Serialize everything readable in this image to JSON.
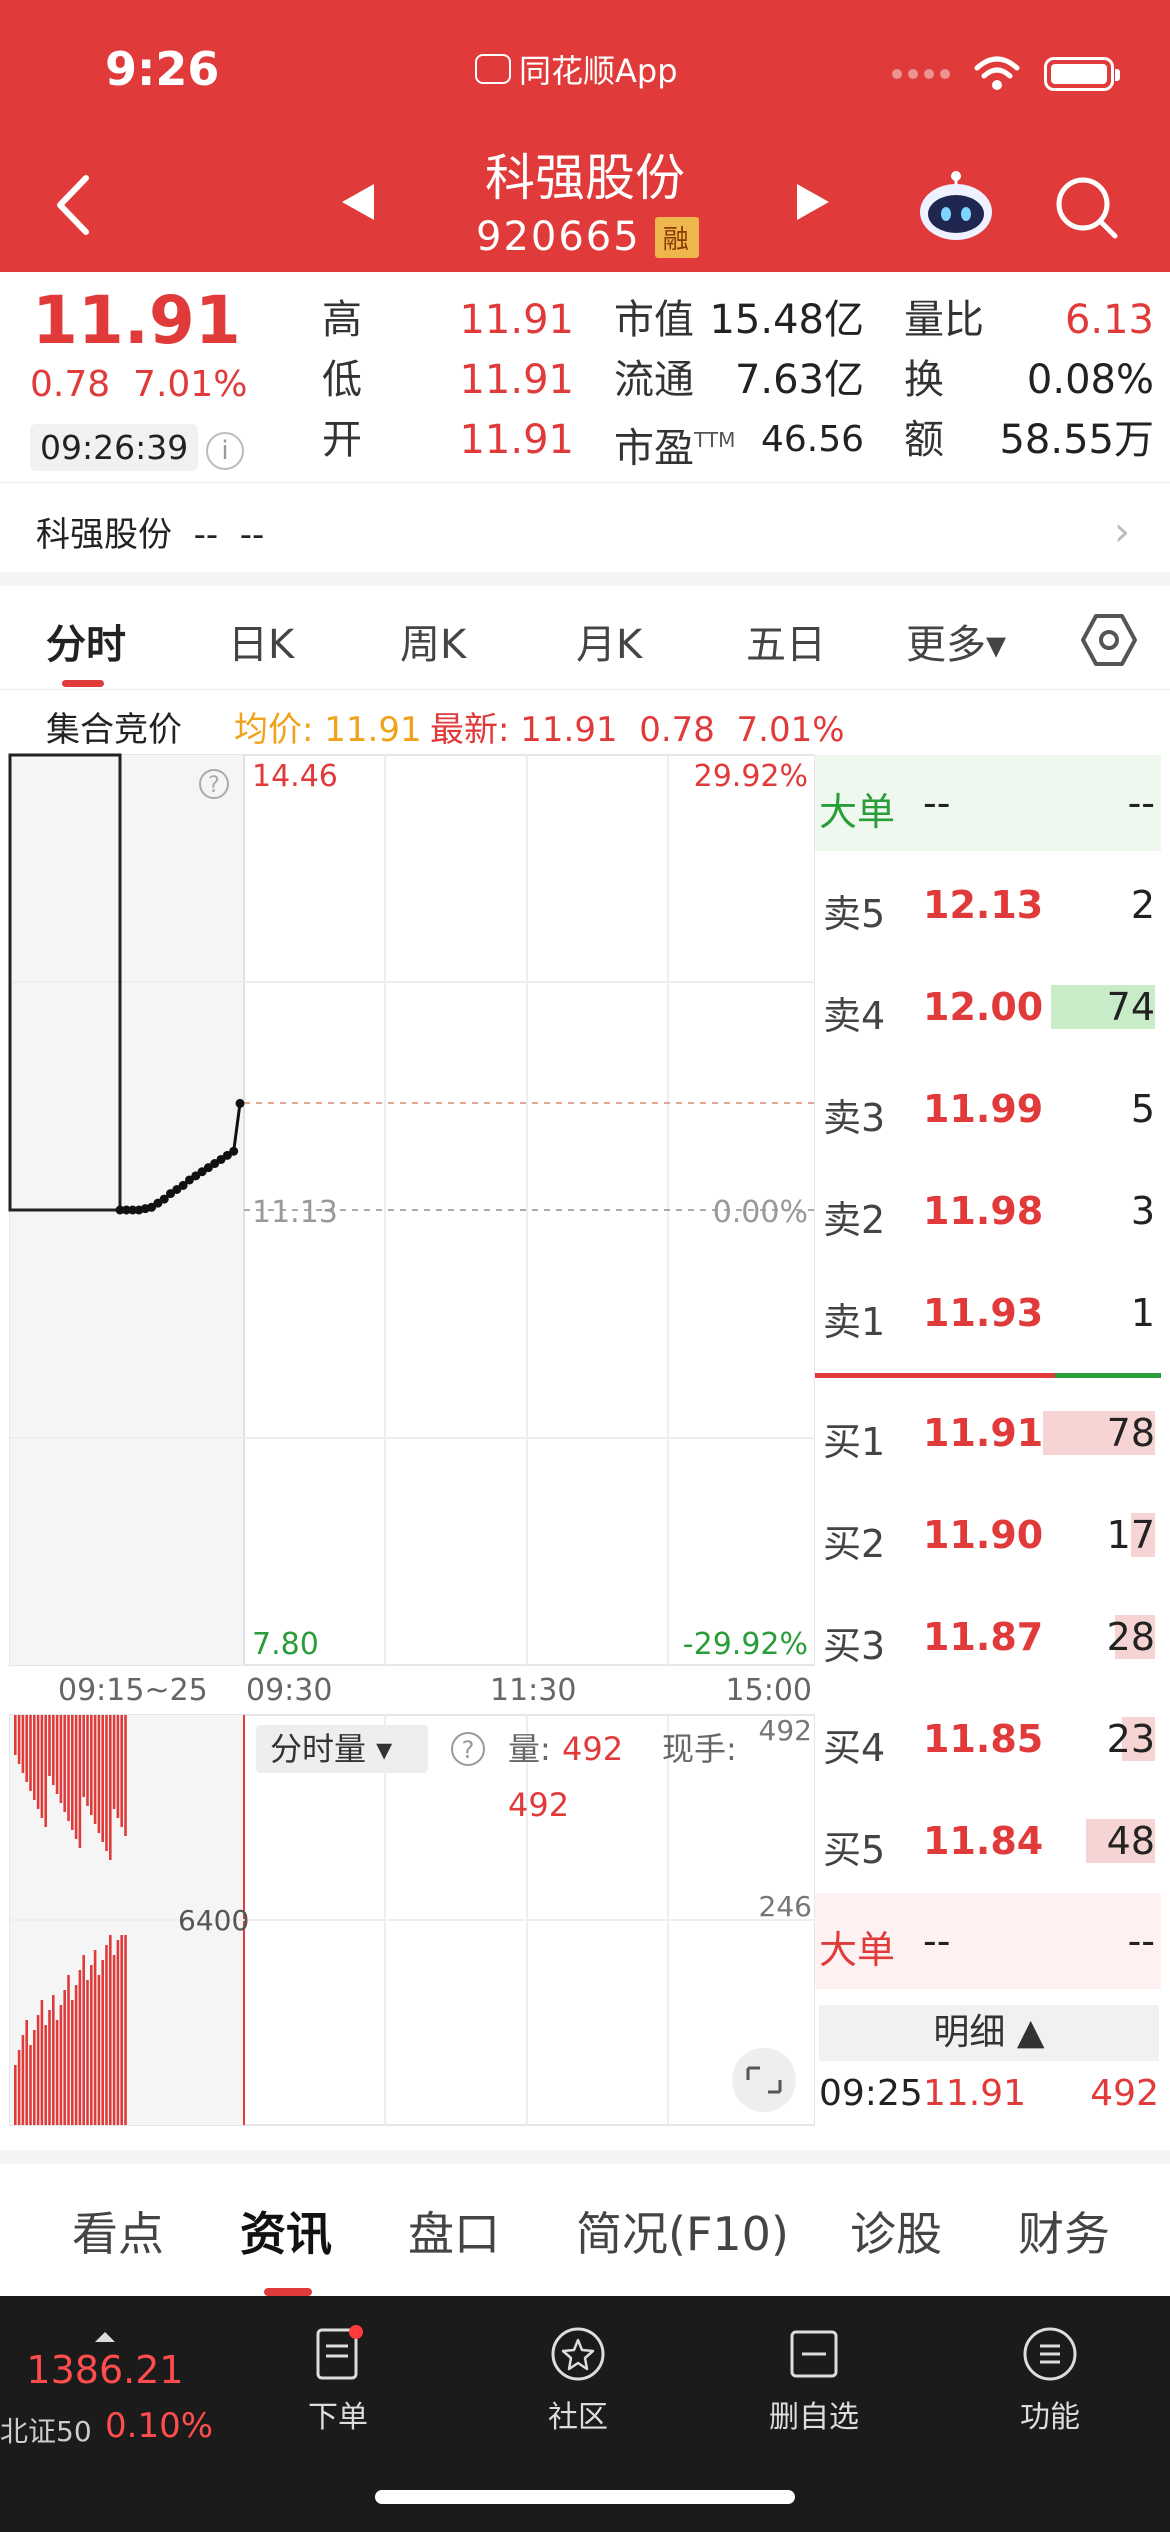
{
  "status": {
    "time": "9:26",
    "app_label": "同花顺App"
  },
  "header": {
    "stock_name": "科强股份",
    "stock_code": "920665",
    "badge": "融"
  },
  "quote": {
    "price": "11.91",
    "change": "0.78",
    "change_pct": "7.01%",
    "time": "09:26:39",
    "info_icon": "i",
    "rows": [
      {
        "l1": "高",
        "v1": "11.91",
        "l2": "市值",
        "v2": "15.48亿",
        "l3": "量比",
        "v3": "6.13"
      },
      {
        "l1": "低",
        "v1": "11.91",
        "l2": "流通",
        "v2": "7.63亿",
        "l3": "换",
        "v3": "0.08%"
      },
      {
        "l1": "开",
        "v1": "11.91",
        "l2": "市盈",
        "l2sup": "TTM",
        "v2": "46.56",
        "l3": "额",
        "v3": "58.55万"
      }
    ]
  },
  "related": {
    "text": "科强股份  --  --",
    "chevron": "›"
  },
  "chart_tabs": [
    "分时",
    "日K",
    "周K",
    "月K",
    "五日",
    "更多▾"
  ],
  "subhead": {
    "auction_label": "集合竞价",
    "avg": "均价: 11.91",
    "latest": "最新: 11.91  0.78  7.01%"
  },
  "chart": {
    "help": "?",
    "y_top_price": "14.46",
    "y_top_pct": "29.92%",
    "y_mid_price": "11.13",
    "y_mid_pct": "0.00%",
    "y_bot_price": "7.80",
    "y_bot_pct": "-29.92%",
    "x_labels": [
      "09:15~25",
      "09:30",
      "11:30",
      "15:00"
    ],
    "vol_max": "492",
    "vol_mid": "246",
    "auction_vol_label": "6400",
    "vol_selector": "分时量 ▾",
    "vol_label": "量:",
    "vol_value": "492",
    "vol_label2": "现手:",
    "vol_value2": "492"
  },
  "chart_data": {
    "type": "line",
    "title": "",
    "xlabel": "",
    "ylabel": "",
    "x_range": [
      "09:15",
      "09:25"
    ],
    "ylim": [
      7.8,
      14.46
    ],
    "prev_close": 11.13,
    "series": [
      {
        "values": [
          11.13,
          11.13,
          11.13,
          11.13,
          11.14,
          11.15,
          11.18,
          11.21,
          11.25,
          11.28,
          11.31,
          11.35,
          11.38,
          11.41,
          11.44,
          11.47,
          11.5,
          11.53,
          11.56,
          11.91
        ]
      }
    ]
  },
  "order_book": {
    "big_top": {
      "label": "大单",
      "v1": "--",
      "v2": "--"
    },
    "asks": [
      {
        "label": "卖5",
        "price": "12.13",
        "vol": "2"
      },
      {
        "label": "卖4",
        "price": "12.00",
        "vol": "74"
      },
      {
        "label": "卖3",
        "price": "11.99",
        "vol": "5"
      },
      {
        "label": "卖2",
        "price": "11.98",
        "vol": "3"
      },
      {
        "label": "卖1",
        "price": "11.93",
        "vol": "1"
      }
    ],
    "bids": [
      {
        "label": "买1",
        "price": "11.91",
        "vol": "78"
      },
      {
        "label": "买2",
        "price": "11.90",
        "vol": "17"
      },
      {
        "label": "买3",
        "price": "11.87",
        "vol": "28"
      },
      {
        "label": "买4",
        "price": "11.85",
        "vol": "23"
      },
      {
        "label": "买5",
        "price": "11.84",
        "vol": "48"
      }
    ],
    "big_bottom": {
      "label": "大单",
      "v1": "--",
      "v2": "--"
    },
    "detail_label": "明细 ▲",
    "detail": {
      "time": "09:25",
      "price": "11.91",
      "vol": "492"
    }
  },
  "bottom_tabs": [
    "看点",
    "资讯",
    "盘口",
    "简况(F10)",
    "诊股",
    "财务"
  ],
  "dock": {
    "index_value": "1386.21",
    "index_name": "北证50",
    "index_pct": "0.10%",
    "items": [
      "下单",
      "社区",
      "删自选",
      "功能"
    ]
  },
  "colors": {
    "brand": "#e03a3a",
    "up": "#e03a3a",
    "down": "#2a9d3a",
    "dark": "#1b1b1b"
  }
}
